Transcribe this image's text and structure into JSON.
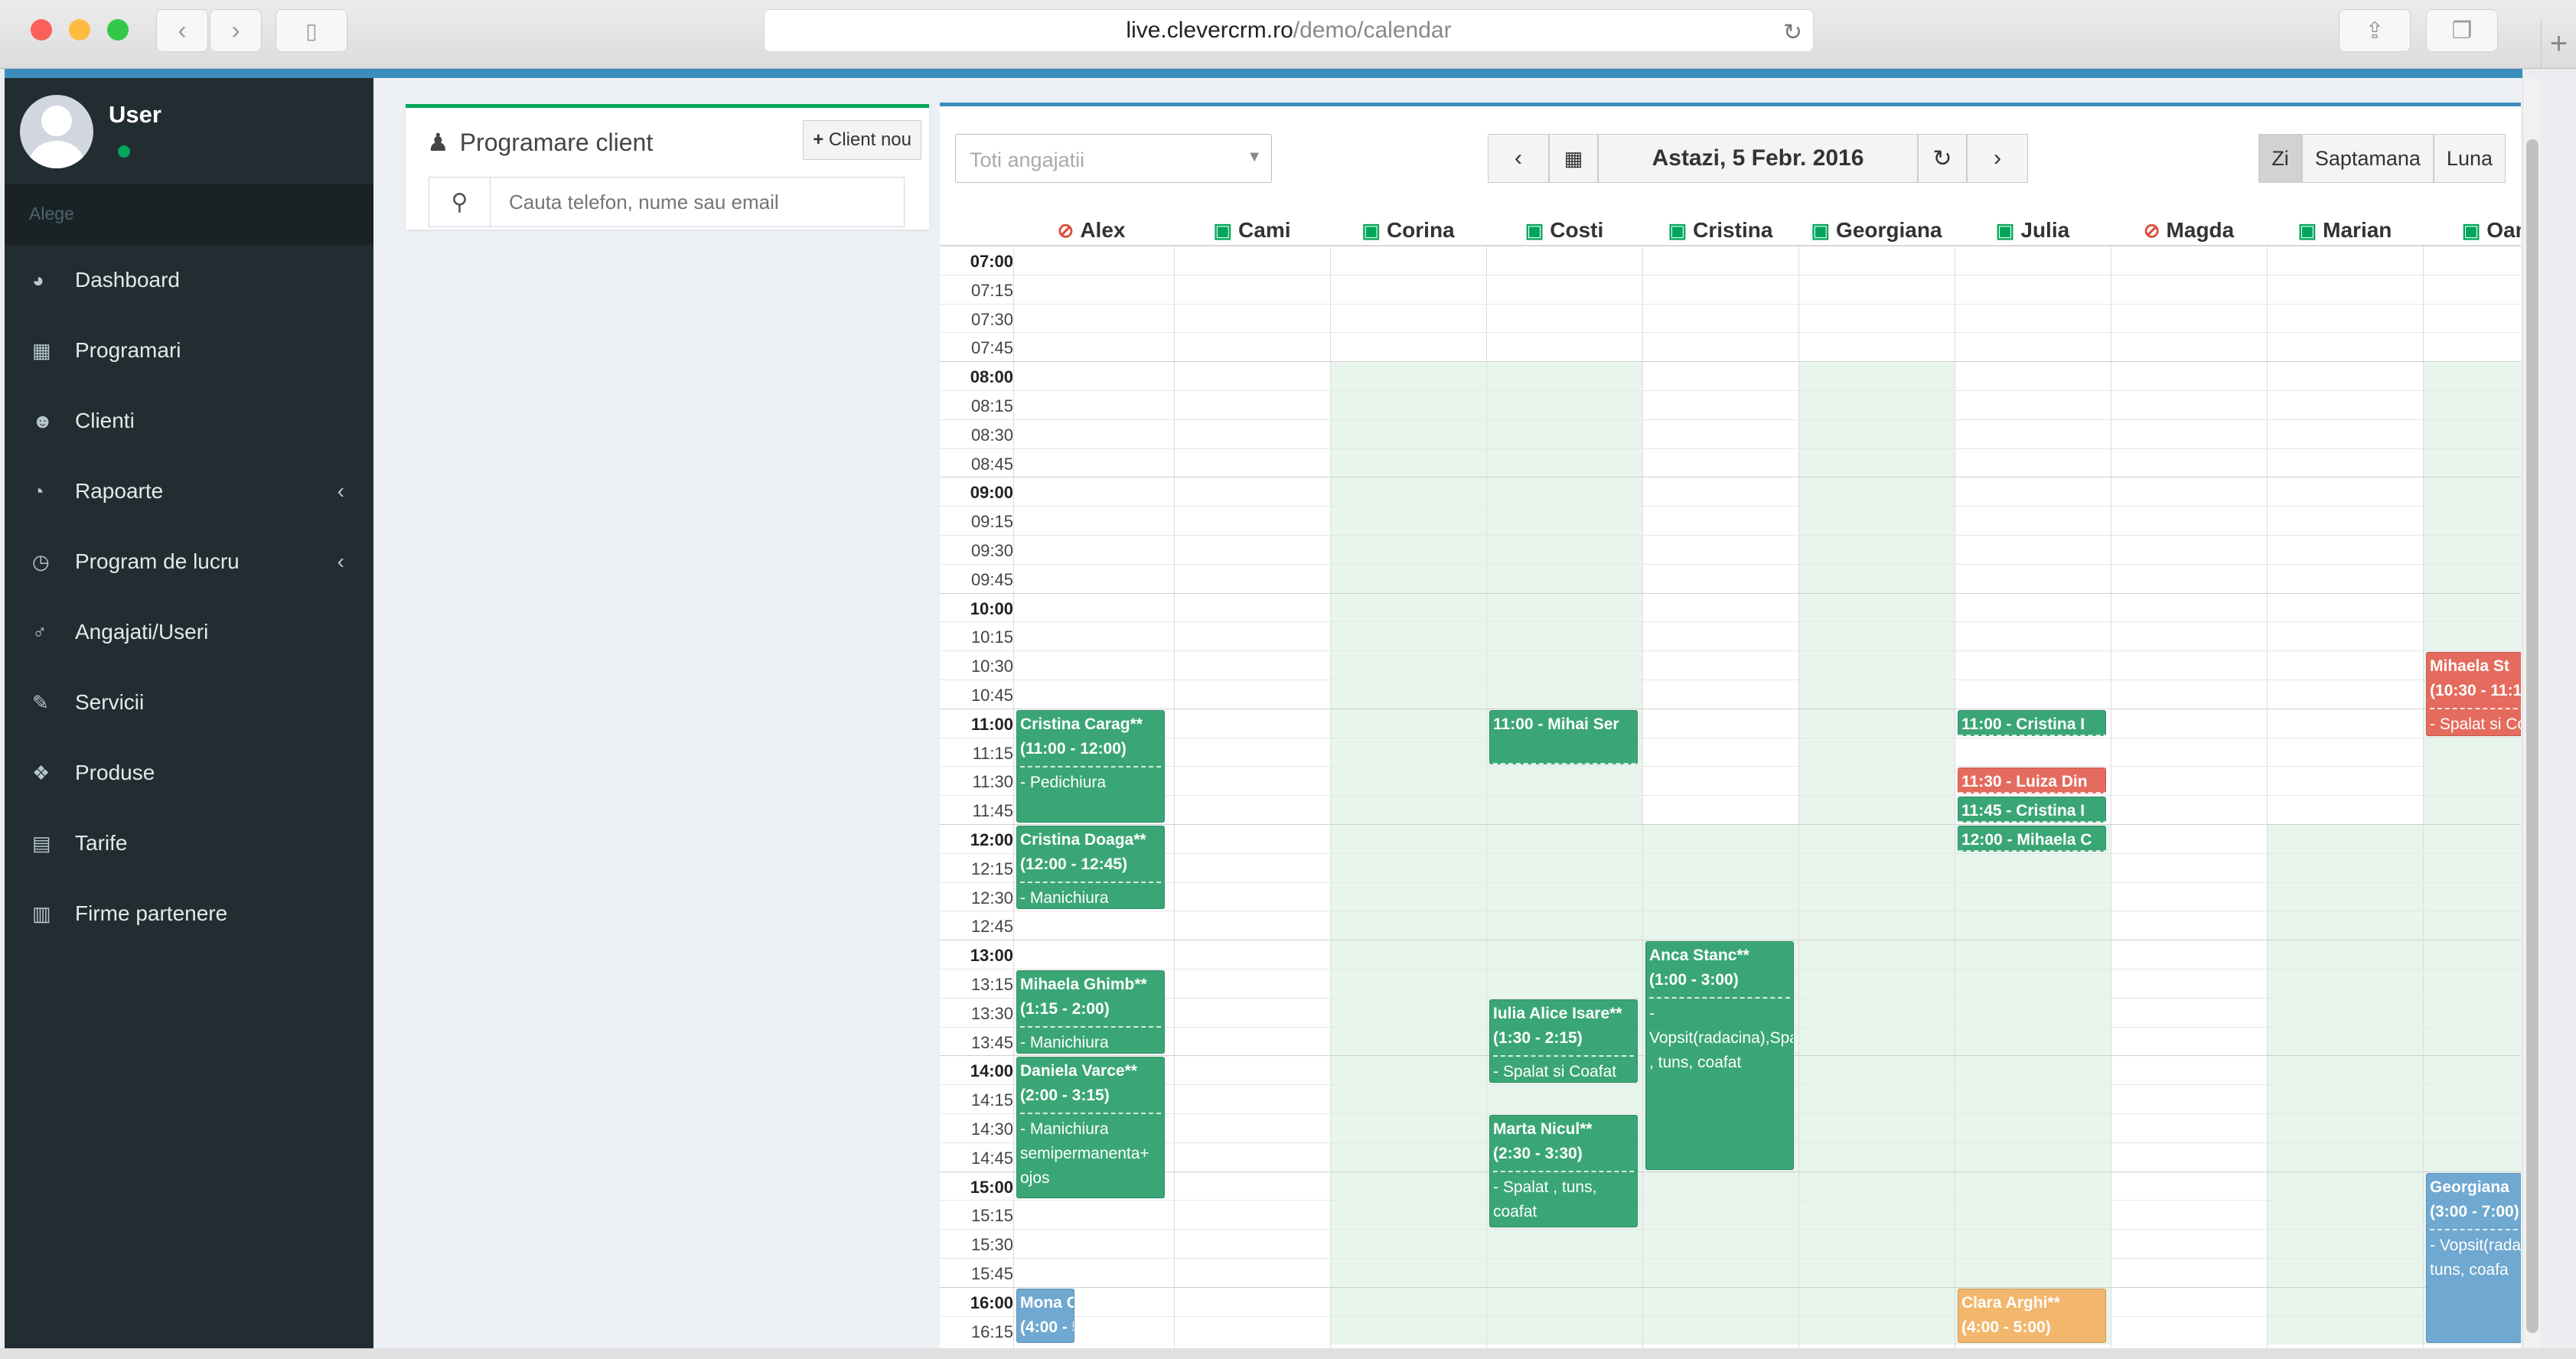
{
  "browser": {
    "url_host": "live.clevercrm.ro",
    "url_path": "/demo/calendar"
  },
  "colors": {
    "accent": "#3c8dbc",
    "green": "#3aa676",
    "red": "#e46b5d",
    "blue": "#6fa8d0",
    "orange": "#f2b66c",
    "sidebar": "#222d32"
  },
  "sidebar": {
    "user": "User",
    "header": "Alege",
    "items": [
      {
        "label": "Dashboard",
        "icon": "dashboard-icon",
        "glyph": "◕",
        "submenu": false
      },
      {
        "label": "Programari",
        "icon": "calendar-icon",
        "glyph": "▦",
        "submenu": false
      },
      {
        "label": "Clienti",
        "icon": "users-icon",
        "glyph": "☻",
        "submenu": false
      },
      {
        "label": "Rapoarte",
        "icon": "pie-chart-icon",
        "glyph": "◔",
        "submenu": true
      },
      {
        "label": "Program de lucru",
        "icon": "clock-icon",
        "glyph": "◷",
        "submenu": true
      },
      {
        "label": "Angajati/Useri",
        "icon": "male-icon",
        "glyph": "♂",
        "submenu": false
      },
      {
        "label": "Servicii",
        "icon": "magic-icon",
        "glyph": "✎",
        "submenu": false
      },
      {
        "label": "Produse",
        "icon": "cubes-icon",
        "glyph": "❖",
        "submenu": false
      },
      {
        "label": "Tarife",
        "icon": "book-icon",
        "glyph": "▤",
        "submenu": false
      },
      {
        "label": "Firme partenere",
        "icon": "building-icon",
        "glyph": "▥",
        "submenu": false
      }
    ]
  },
  "client_box": {
    "title": "Programare client",
    "new_button": "Client nou",
    "search_placeholder": "Cauta telefon, nume sau email"
  },
  "calendar": {
    "employee_select": "Toti angajatii",
    "date_label": "Astazi, 5 Febr. 2016",
    "views": [
      "Zi",
      "Saptamana",
      "Luna"
    ],
    "active_view": "Zi",
    "columns": [
      {
        "name": "Alex",
        "status": "off"
      },
      {
        "name": "Cami",
        "status": "on"
      },
      {
        "name": "Corina",
        "status": "on"
      },
      {
        "name": "Costi",
        "status": "on"
      },
      {
        "name": "Cristina",
        "status": "on"
      },
      {
        "name": "Georgiana",
        "status": "on"
      },
      {
        "name": "Julia",
        "status": "on"
      },
      {
        "name": "Magda",
        "status": "off"
      },
      {
        "name": "Marian",
        "status": "on"
      },
      {
        "name": "Oana",
        "status": "on"
      }
    ],
    "times": [
      "07:00",
      "07:15",
      "07:30",
      "07:45",
      "08:00",
      "08:15",
      "08:30",
      "08:45",
      "09:00",
      "09:15",
      "09:30",
      "09:45",
      "10:00",
      "10:15",
      "10:30",
      "10:45",
      "11:00",
      "11:15",
      "11:30",
      "11:45",
      "12:00",
      "12:15",
      "12:30",
      "12:45",
      "13:00",
      "13:15",
      "13:30",
      "13:45",
      "14:00",
      "14:15",
      "14:30",
      "14:45",
      "15:00",
      "15:15",
      "15:30",
      "15:45",
      "16:00",
      "16:15"
    ],
    "availability": [
      {
        "col": 2,
        "from": "08:00",
        "to": "16:30"
      },
      {
        "col": 3,
        "from": "08:00",
        "to": "16:30"
      },
      {
        "col": 4,
        "from": "12:00",
        "to": "16:30"
      },
      {
        "col": 5,
        "from": "08:00",
        "to": "16:30"
      },
      {
        "col": 6,
        "from": "12:00",
        "to": "16:30"
      },
      {
        "col": 8,
        "from": "12:00",
        "to": "16:30"
      },
      {
        "col": 9,
        "from": "08:00",
        "to": "16:30"
      }
    ],
    "appointments": [
      {
        "col": 0,
        "start": "11:00",
        "end": "12:00",
        "color": "green",
        "name": "Cristina Carag**",
        "time": "(11:00 - 12:00)",
        "service": "- Pedichiura"
      },
      {
        "col": 0,
        "start": "12:00",
        "end": "12:45",
        "color": "green",
        "name": "Cristina Doaga**",
        "time": "(12:00 - 12:45)",
        "service": "- Manichiura"
      },
      {
        "col": 0,
        "start": "13:15",
        "end": "14:00",
        "color": "green",
        "name": "Mihaela Ghimb**",
        "time": "(1:15 - 2:00)",
        "service": "- Manichiura"
      },
      {
        "col": 0,
        "start": "14:00",
        "end": "15:15",
        "color": "green",
        "name": "Daniela Varce**",
        "time": "(2:00 - 3:15)",
        "service": "- Manichiura semipermanenta+ ojos"
      },
      {
        "col": 0,
        "start": "16:00",
        "end": "16:30",
        "color": "blue",
        "name": "Mona C",
        "time": "(4:00 - 5",
        "service": "",
        "narrow": true
      },
      {
        "col": 3,
        "start": "11:00",
        "end": "11:30",
        "color": "green",
        "name": "11:00 - Mihai Ser",
        "time": "",
        "service": ""
      },
      {
        "col": 3,
        "start": "13:30",
        "end": "14:15",
        "color": "green",
        "name": "Iulia Alice Isare**",
        "time": "(1:30 - 2:15)",
        "service": "- Spalat si Coafat"
      },
      {
        "col": 3,
        "start": "14:30",
        "end": "15:30",
        "color": "green",
        "name": "Marta Nicul**",
        "time": "(2:30 - 3:30)",
        "service": "- Spalat , tuns, coafat"
      },
      {
        "col": 4,
        "start": "13:00",
        "end": "15:00",
        "color": "green",
        "name": "Anca Stanc**",
        "time": "(1:00 - 3:00)",
        "service": "- Vopsit(radacina),Spalat , tuns, coafat"
      },
      {
        "col": 6,
        "start": "11:00",
        "end": "11:15",
        "color": "green",
        "name": "11:00 - Cristina I",
        "time": "",
        "service": ""
      },
      {
        "col": 6,
        "start": "11:30",
        "end": "11:45",
        "color": "red",
        "name": "11:30 - Luiza Din",
        "time": "",
        "service": ""
      },
      {
        "col": 6,
        "start": "11:45",
        "end": "12:00",
        "color": "green",
        "name": "11:45 - Cristina I",
        "time": "",
        "service": ""
      },
      {
        "col": 6,
        "start": "12:00",
        "end": "12:15",
        "color": "green",
        "name": "12:00 - Mihaela C",
        "time": "",
        "service": ""
      },
      {
        "col": 6,
        "start": "16:00",
        "end": "16:30",
        "color": "orange",
        "name": "Clara Arghi**",
        "time": "(4:00 - 5:00)",
        "service": ""
      },
      {
        "col": 9,
        "start": "10:30",
        "end": "11:15",
        "color": "red",
        "name": "Mihaela St",
        "time": "(10:30 - 11:1",
        "service": "- Spalat si Co"
      },
      {
        "col": 9,
        "start": "15:00",
        "end": "16:30",
        "color": "blue",
        "name": "Georgiana",
        "time": "(3:00 - 7:00)",
        "service": "- Vopsit(radac , tuns, coafa"
      }
    ]
  }
}
